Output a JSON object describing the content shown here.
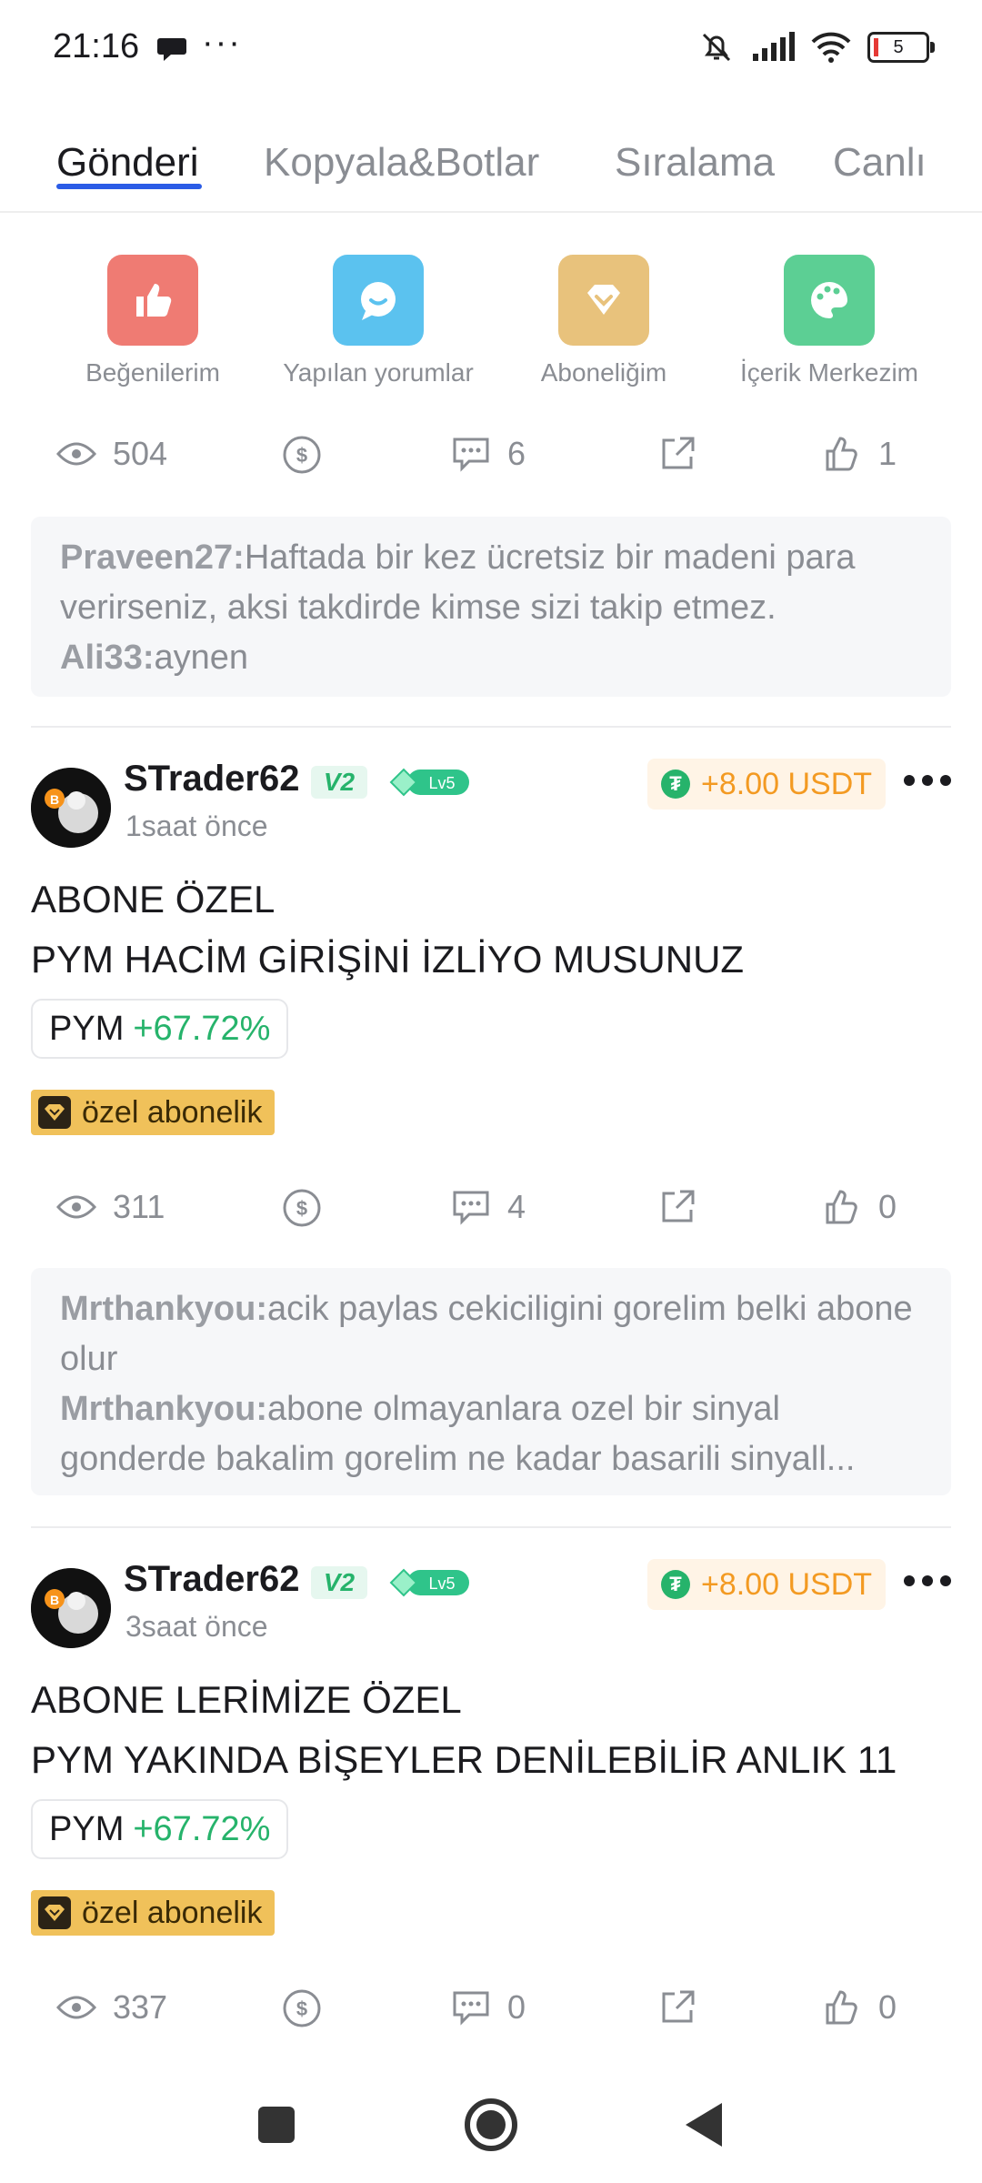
{
  "status_bar": {
    "time": "21:16",
    "dots": "···",
    "battery": "5"
  },
  "tabs": [
    {
      "label": "Gönderi",
      "active": true
    },
    {
      "label": "Kopyala&Botlar",
      "active": false
    },
    {
      "label": "Sıralama",
      "active": false
    },
    {
      "label": "Canlı",
      "active": false
    }
  ],
  "quick_actions": [
    {
      "label": "Beğenilerim",
      "icon": "thumbs-up-icon",
      "color": "#ef7b73"
    },
    {
      "label": "Yapılan yorumlar",
      "icon": "chat-bubble-icon",
      "color": "#5bc2ef"
    },
    {
      "label": "Aboneliğim",
      "icon": "diamond-icon",
      "color": "#e8c27c"
    },
    {
      "label": "İçerik Merkezim",
      "icon": "palette-icon",
      "color": "#5ccf94"
    }
  ],
  "top_stats": {
    "views": "504",
    "comments": "6",
    "likes": "1"
  },
  "top_comments": [
    {
      "user": "Praveen27:",
      "text": "Haftada bir kez ücretsiz bir madeni para verirseniz, aksi takdirde kimse sizi takip etmez."
    },
    {
      "user": "Ali33:",
      "text": "aynen"
    }
  ],
  "posts": [
    {
      "username": "STrader62",
      "vip": "V2",
      "level": "Lv5",
      "time": "1saat önce",
      "tip": "+8.00 USDT",
      "text_line1": "ABONE ÖZEL",
      "text_line2": "PYM HACİM GİRİŞİNİ İZLİYO MUSUNUZ",
      "coin": "PYM",
      "change": "+67.72%",
      "tag": "özel abonelik",
      "views": "311",
      "comments": "4",
      "likes": "0",
      "comment_list": [
        {
          "user": "Mrthankyou:",
          "text": "acik paylas cekiciligini gorelim belki abone olur"
        },
        {
          "user": "Mrthankyou:",
          "text": "abone olmayanlara ozel bir sinyal gonderde bakalim gorelim ne kadar basarili sinyall..."
        }
      ]
    },
    {
      "username": "STrader62",
      "vip": "V2",
      "level": "Lv5",
      "time": "3saat önce",
      "tip": "+8.00 USDT",
      "text_line1": "ABONE LERİMİZE ÖZEL",
      "text_line2": "PYM YAKINDA BİŞEYLER DENİLEBİLİR ANLIK 11",
      "coin": "PYM",
      "change": "+67.72%",
      "tag": "özel abonelik",
      "views": "337",
      "comments": "0",
      "likes": "0"
    }
  ],
  "nav": {
    "icons": [
      "square-recents-icon",
      "circle-home-icon",
      "triangle-back-icon"
    ]
  }
}
